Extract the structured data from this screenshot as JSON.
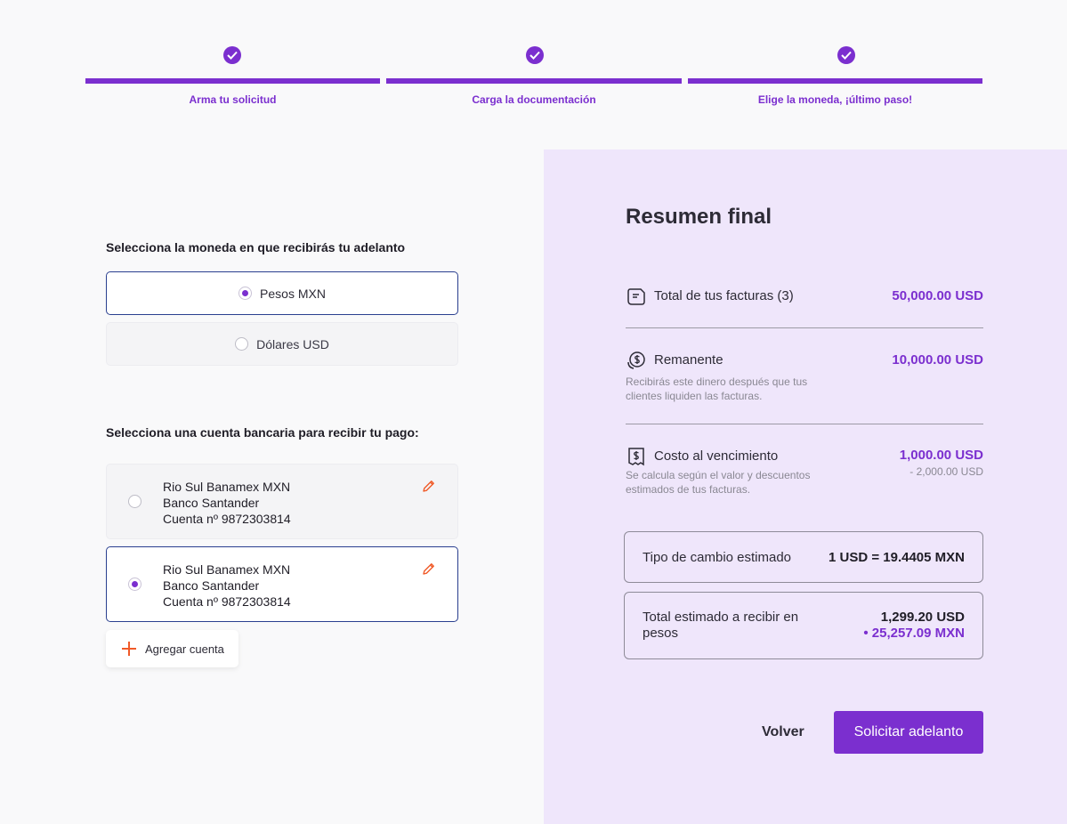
{
  "stepper": {
    "steps": [
      {
        "label": "Arma tu solicitud"
      },
      {
        "label": "Carga la documentación"
      },
      {
        "label": "Elige la moneda, ¡último paso!"
      }
    ]
  },
  "currency": {
    "title": "Selecciona la moneda en que recibirás tu adelanto",
    "options": [
      {
        "label": "Pesos MXN",
        "selected": true
      },
      {
        "label": "Dólares USD",
        "selected": false
      }
    ]
  },
  "accounts": {
    "title": "Selecciona una cuenta bancaria para recibir tu pago:",
    "items": [
      {
        "name": "Rio Sul Banamex MXN",
        "bank": "Banco Santander",
        "number": "Cuenta nº 9872303814",
        "selected": false
      },
      {
        "name": "Rio Sul Banamex MXN",
        "bank": "Banco Santander",
        "number": "Cuenta nº 9872303814",
        "selected": true
      }
    ],
    "add_label": "Agregar cuenta"
  },
  "summary": {
    "title": "Resumen final",
    "invoices": {
      "label": "Total de tus facturas (3)",
      "amount": "50,000.00 USD",
      "icon": "invoice-icon"
    },
    "remainder": {
      "label": "Remanente",
      "amount": "10,000.00 USD",
      "note": "Recibirás este dinero después que tus clientes liquiden las facturas.",
      "icon": "dollar-coin-icon"
    },
    "cost": {
      "label": "Costo al vencimiento",
      "amount": "1,000.00 USD",
      "sub_amount": "- 2,000.00 USD",
      "note": "Se calcula según el valor y descuentos estimados de tus facturas.",
      "icon": "receipt-dollar-icon"
    },
    "exchange": {
      "label": "Tipo de cambio estimado",
      "value": "1 USD = 19.4405 MXN"
    },
    "total": {
      "label": "Total estimado a recibir en pesos",
      "usd": "1,299.20 USD",
      "mxn": "•  25,257.09 MXN"
    },
    "back_label": "Volver",
    "submit_label": "Solicitar adelanto"
  },
  "colors": {
    "accent": "#7b2fcf",
    "panel": "#efe6fb",
    "edit": "#f05a28"
  }
}
